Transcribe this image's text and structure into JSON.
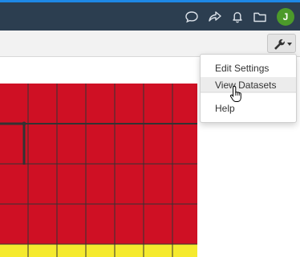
{
  "colors": {
    "accent_strip": "#1e88e5",
    "navbar_bg": "#2c3e50",
    "avatar_bg": "#4c9a2a",
    "cell_red": "#cf1024",
    "cell_yellow": "#f5ea2e",
    "grid_line": "#333333"
  },
  "navbar": {
    "icons": [
      "comment-icon",
      "share-icon",
      "bell-icon",
      "folder-icon"
    ],
    "avatar_initial": "J"
  },
  "toolbar": {
    "tool_icon": "wrench-icon"
  },
  "dropdown": {
    "items": [
      {
        "label": "Edit Settings"
      },
      {
        "label": "View Datasets",
        "active": true
      },
      {
        "label": "Help"
      }
    ]
  }
}
